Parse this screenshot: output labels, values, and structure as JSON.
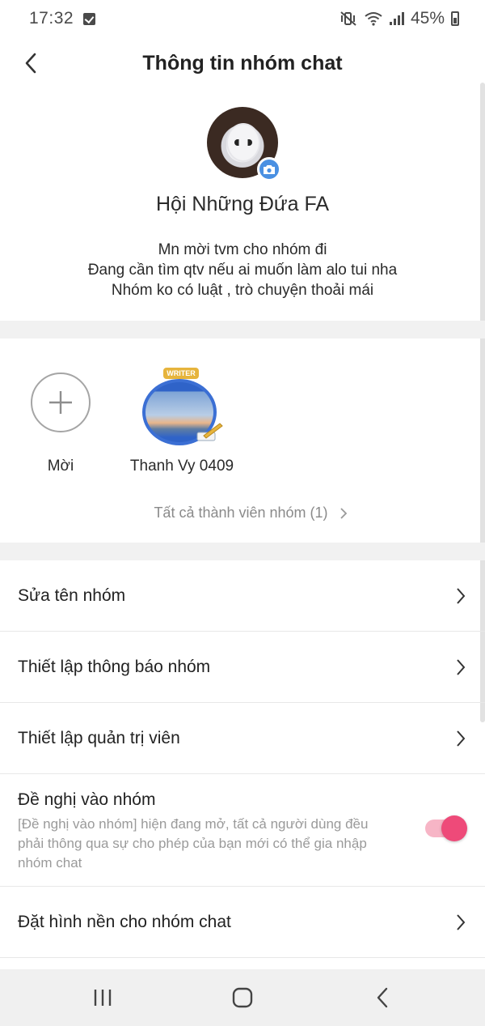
{
  "status_bar": {
    "time": "17:32",
    "battery": "45%",
    "icons": [
      "checkbox-notification-icon",
      "mute-vibrate-icon",
      "wifi-icon",
      "signal-icon",
      "battery-icon"
    ]
  },
  "header": {
    "title": "Thông tin nhóm chat",
    "back_icon": "chevron-left-icon"
  },
  "group": {
    "name": "Hội Những Đứa FA",
    "description_lines": [
      "Mn mời tvm cho nhóm đi",
      "Đang cần tìm qtv nếu ai muốn làm alo tui nha",
      "Nhóm ko có luật , trò chuyện thoải mái"
    ],
    "avatar_badge": "camera-icon"
  },
  "members": {
    "invite_label": "Mời",
    "list": [
      {
        "name": "Thanh Vy 0409",
        "badge": "WRITER"
      }
    ],
    "all_members_label": "Tất cả thành viên nhóm (1)"
  },
  "settings": {
    "rename": "Sửa tên nhóm",
    "notifications": "Thiết lập thông báo nhóm",
    "admins": "Thiết lập quản trị viên",
    "join_request": {
      "label": "Đề nghị vào nhóm",
      "description": "[Đề nghị vào nhóm] hiện đang mở, tất cả người dùng đều phải thông qua sự cho phép của bạn mới có thể gia nhập nhóm chat",
      "enabled": true
    },
    "wallpaper": "Đặt hình nền cho nhóm chat"
  },
  "colors": {
    "accent_pink": "#ee4a79",
    "camera_blue": "#4a90e2"
  },
  "nav_bar": {
    "icons": [
      "recent-apps-icon",
      "home-icon",
      "back-nav-icon"
    ]
  }
}
